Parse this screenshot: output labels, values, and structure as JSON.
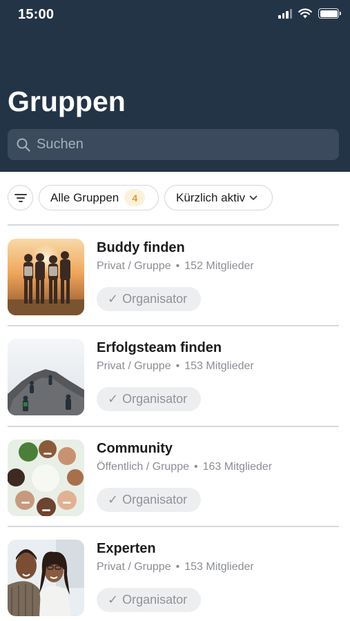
{
  "status_bar": {
    "time": "15:00"
  },
  "header": {
    "title": "Gruppen",
    "search_placeholder": "Suchen",
    "background_color": "#243447"
  },
  "filters": {
    "filter_icon": "filter-icon",
    "all_groups_label": "Alle Gruppen",
    "all_groups_count": "4",
    "sort_label": "Kürzlich aktiv"
  },
  "groups": [
    {
      "name": "Buddy finden",
      "type": "Privat / Gruppe",
      "members": "152 Mitglieder",
      "role": "Organisator",
      "image": "friends-sunset-photo"
    },
    {
      "name": "Erfolgsteam finden",
      "type": "Privat / Gruppe",
      "members": "153 Mitglieder",
      "role": "Organisator",
      "image": "mountain-climbers-photo"
    },
    {
      "name": "Community",
      "type": "Öffentlich / Gruppe",
      "members": "163 Mitglieder",
      "role": "Organisator",
      "image": "people-circle-photo"
    },
    {
      "name": "Experten",
      "type": "Privat / Gruppe",
      "members": "153 Mitglieder",
      "role": "Organisator",
      "image": "couple-portrait-photo"
    }
  ],
  "colors": {
    "badge_bg": "#fdf1dc",
    "badge_text": "#e39b22",
    "role_badge_bg": "#eceef0"
  }
}
